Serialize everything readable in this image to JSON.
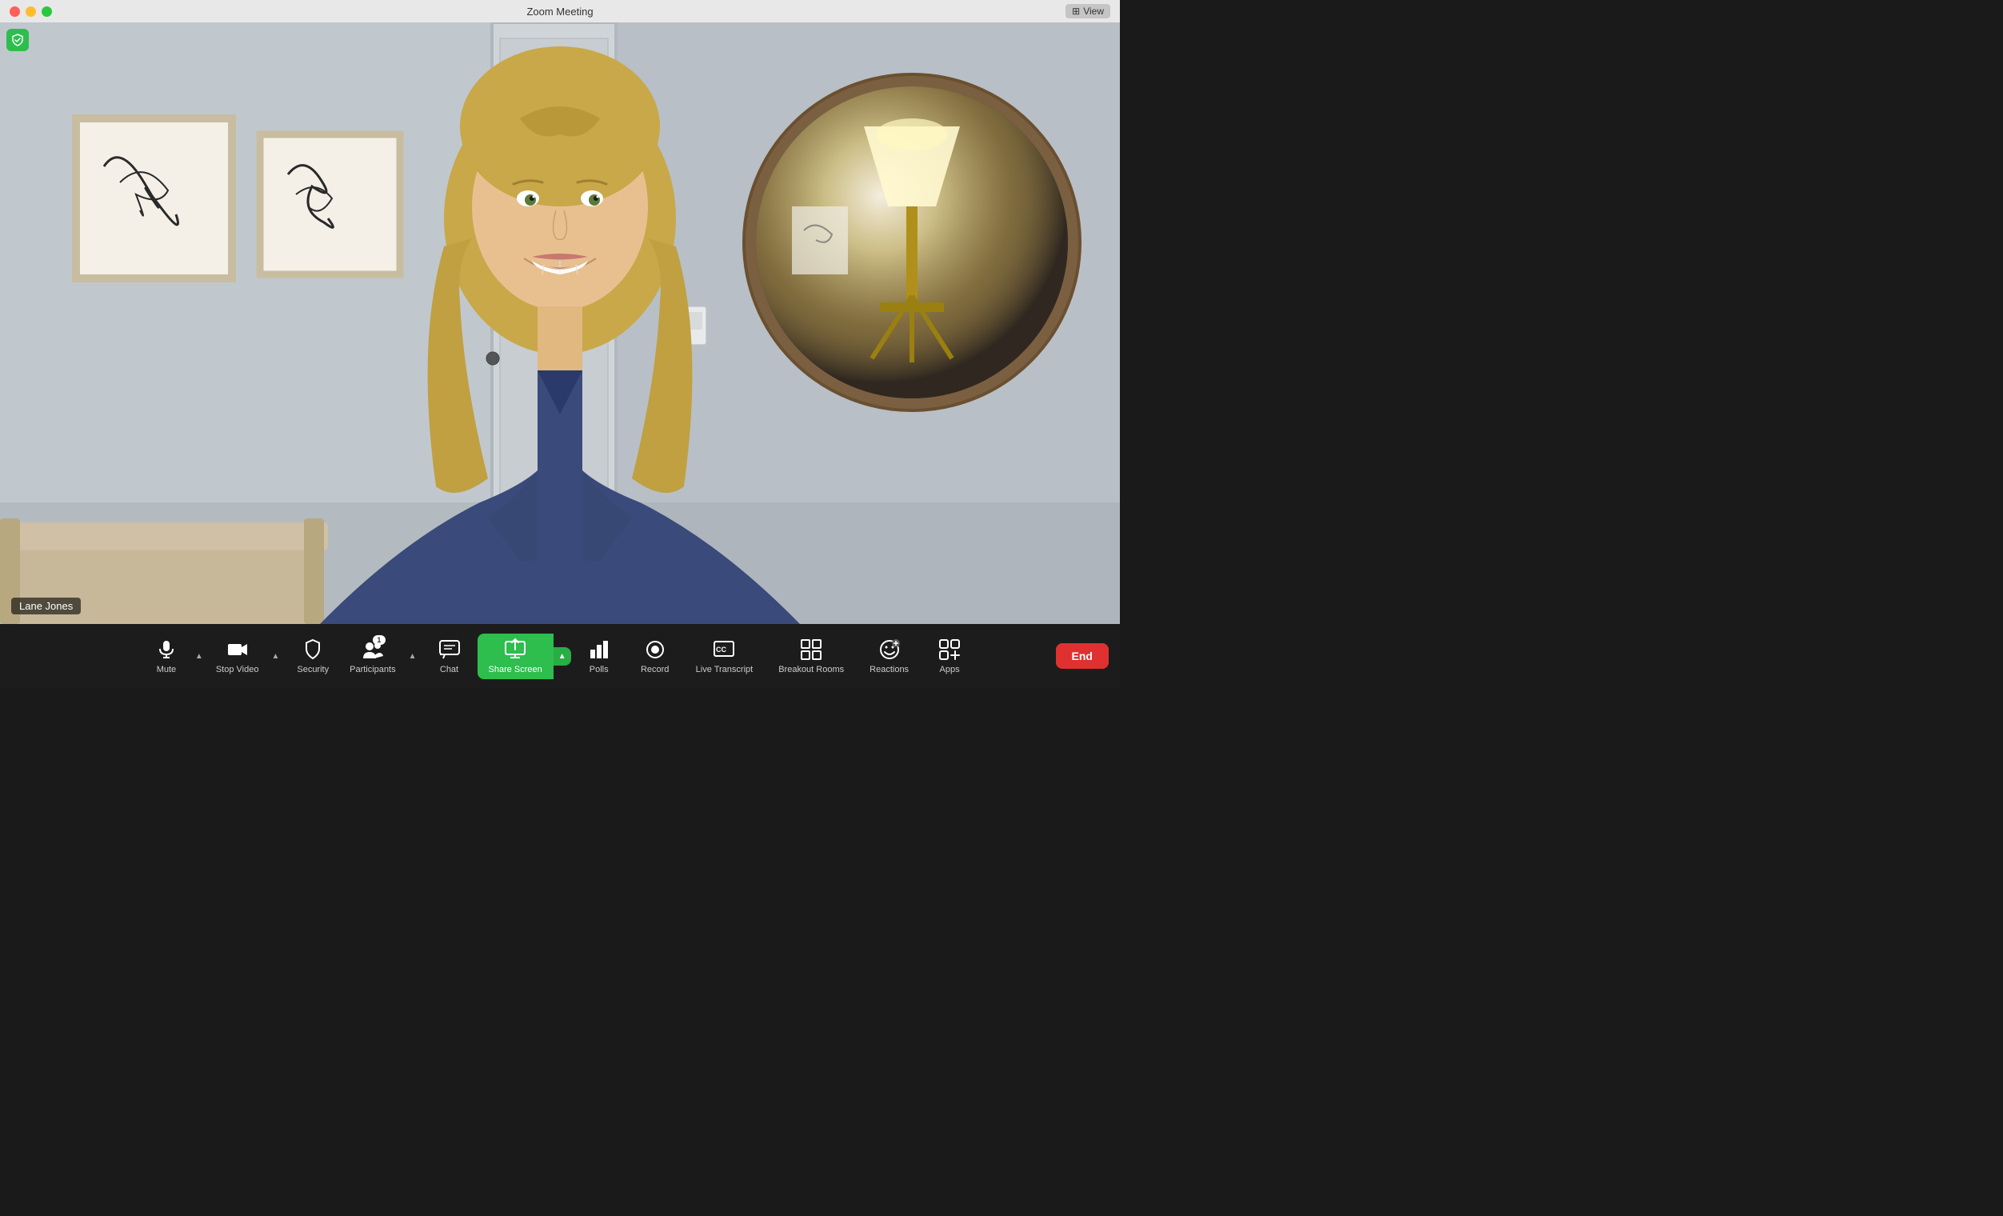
{
  "titlebar": {
    "title": "Zoom Meeting"
  },
  "view_btn": {
    "label": "View",
    "icon": "grid-icon"
  },
  "participant": {
    "name": "Lane Jones"
  },
  "toolbar": {
    "mute_label": "Mute",
    "stop_video_label": "Stop Video",
    "security_label": "Security",
    "participants_label": "Participants",
    "participants_count": "1",
    "chat_label": "Chat",
    "share_screen_label": "Share Screen",
    "polls_label": "Polls",
    "record_label": "Record",
    "live_transcript_label": "Live Transcript",
    "breakout_rooms_label": "Breakout Rooms",
    "reactions_label": "Reactions",
    "apps_label": "Apps",
    "end_label": "End"
  }
}
